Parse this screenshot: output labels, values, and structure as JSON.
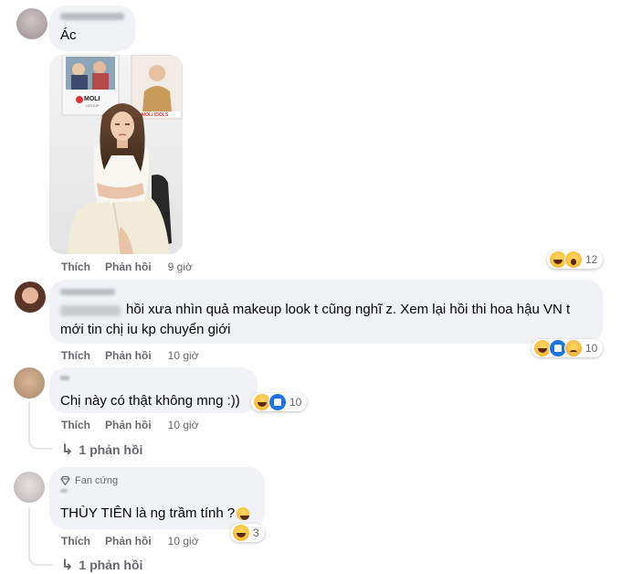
{
  "comments": [
    {
      "text": "Ác",
      "photo_alt": "woman-in-white-dress-photo",
      "actions": {
        "like": "Thích",
        "reply": "Phản hồi",
        "time": "9 giờ"
      },
      "reaction_count": "12",
      "reaction_icons": [
        "haha-icon",
        "wow-icon"
      ]
    },
    {
      "text_line1": "hồi xưa nhìn quả makeup look t cũng nghĩ z. Xem lại hồi thi hoa hậu VN t",
      "text_line2": "mới tin chị iu kp chuyển giới",
      "actions": {
        "like": "Thích",
        "reply": "Phản hồi",
        "time": "10 giờ"
      },
      "reaction_count": "10",
      "reaction_icons": [
        "haha-icon",
        "like-icon",
        "sad-icon"
      ]
    },
    {
      "text": "Chị này có thật không mng :))",
      "actions": {
        "like": "Thích",
        "reply": "Phản hồi",
        "time": "10 giờ"
      },
      "reaction_count": "10",
      "reaction_icons": [
        "haha-icon",
        "like-icon"
      ],
      "replies_label": "1 phản hồi"
    },
    {
      "badge": "Fan cứng",
      "text": "THÙY TIÊN là ng trầm tính ?",
      "actions": {
        "like": "Thích",
        "reply": "Phản hồi",
        "time": "10 giờ"
      },
      "reaction_count": "3",
      "reaction_icons": [
        "haha-icon"
      ],
      "replies_label": "1 phản hồi"
    }
  ],
  "photo_signs": {
    "brand": "MOLI",
    "brand_sub": "GROUP",
    "brand2": "MOLI IDOLS"
  }
}
